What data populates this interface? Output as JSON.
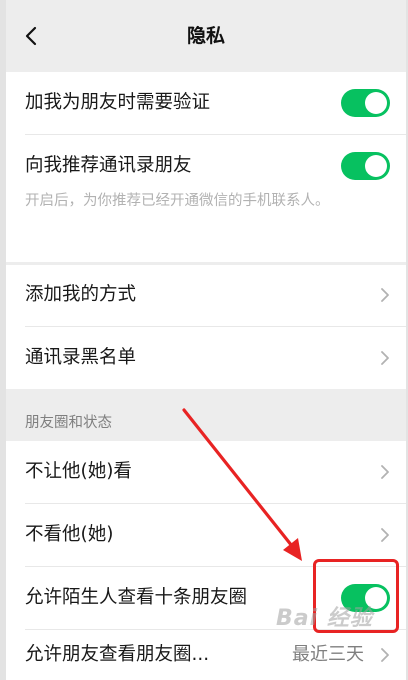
{
  "navbar": {
    "title": "隐私",
    "back_icon": "chevron-left-icon"
  },
  "privacy_group": {
    "verify_label": "加我为朋友时需要验证",
    "verify_toggle": "on",
    "recommend_label": "向我推荐通讯录朋友",
    "recommend_desc": "开启后，为你推荐已经开通微信的手机联系人。",
    "recommend_toggle": "on"
  },
  "nav_group": {
    "add_method_label": "添加我的方式",
    "blacklist_label": "通讯录黑名单"
  },
  "moments_section": {
    "header": "朋友圈和状态",
    "hide_from_label": "不让他(她)看",
    "dont_see_label": "不看他(她)",
    "stranger_label": "允许陌生人查看十条朋友圈",
    "stranger_toggle": "on",
    "range_label": "允许朋友查看朋友圈...",
    "range_value": "最近三天"
  },
  "watermark": "Bai 经验",
  "colors": {
    "toggle_on": "#07c160",
    "annotation_red": "#e82323",
    "background": "#ededed"
  }
}
